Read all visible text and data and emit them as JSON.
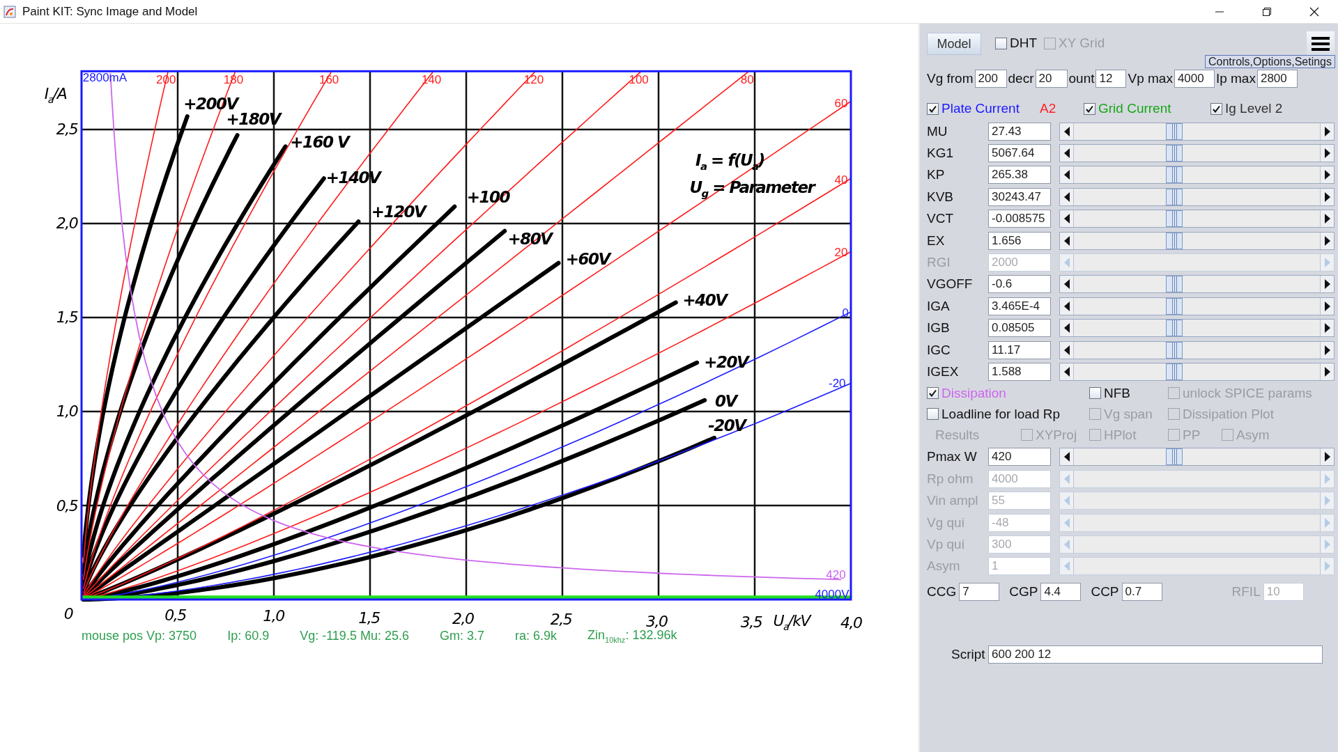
{
  "window": {
    "title": "Paint KIT: Sync Image and Model"
  },
  "plot": {
    "y_axis_label": "I$_{a}$/A",
    "y_ticks": [
      "2,5",
      "2,0",
      "1,5",
      "1,0",
      "0,5"
    ],
    "x_ticks": [
      "0",
      "0,5",
      "1,0",
      "1,5",
      "2,0",
      "2,5",
      "3,0",
      "3,5",
      "4,0"
    ],
    "x_axis_label": "U$_{a}$/kV",
    "curve_labels": [
      "+200V",
      "+180V",
      "+160 V",
      "+140V",
      "+120V",
      "+100",
      "+80V",
      "+60V",
      "+40V",
      "+20V",
      "0V",
      "-20V"
    ],
    "formula": [
      "I$_{a}$ = f(U$_{a}$)",
      "U$_{g}$ = Parameter"
    ],
    "overlay_labels": [
      {
        "text": "2800mA",
        "color": "#2020ff"
      },
      {
        "text": "200",
        "color": "#ff2020"
      },
      {
        "text": "180",
        "color": "#ff2020"
      },
      {
        "text": "160",
        "color": "#ff2020"
      },
      {
        "text": "140",
        "color": "#ff2020"
      },
      {
        "text": "120",
        "color": "#ff2020"
      },
      {
        "text": "100",
        "color": "#ff2020"
      },
      {
        "text": "80",
        "color": "#ff2020"
      },
      {
        "text": "60",
        "color": "#ff2020"
      },
      {
        "text": "40",
        "color": "#ff2020"
      },
      {
        "text": "20",
        "color": "#ff2020"
      },
      {
        "text": "0",
        "color": "#2020ff"
      },
      {
        "text": "-20",
        "color": "#2020ff"
      },
      {
        "text": "420",
        "color": "#cc66ee"
      },
      {
        "text": "4000V",
        "color": "#2020ff"
      }
    ],
    "readout": [
      "mouse pos Vp: 3750",
      "Ip: 60.9",
      "Vg: -119.5 Mu: 25.6",
      "Gm: 3.7",
      "ra: 6.9k",
      "Zin$_{10khz}$: 132.96k"
    ]
  },
  "model_button": "Model",
  "top_checks": [
    {
      "label": "DHT",
      "checked": false,
      "disabled": false
    },
    {
      "label": "XY Grid",
      "checked": false,
      "disabled": true
    }
  ],
  "menu_tooltip": "Controls,Options,Setings",
  "range_fields": [
    {
      "label": "Vg from",
      "value": "200"
    },
    {
      "label": "decr",
      "value": "20"
    },
    {
      "label": "ount",
      "value": "12"
    },
    {
      "label": "Vp max",
      "value": "4000"
    },
    {
      "label": "Ip max",
      "value": "2800"
    }
  ],
  "curve_checks": [
    {
      "kind": "checkbox",
      "label": "Plate Current",
      "checked": true,
      "color": "#1a1aff"
    },
    {
      "kind": "label",
      "label": "A2",
      "color": "#ff2020"
    },
    {
      "kind": "checkbox",
      "label": "Grid Current",
      "checked": true,
      "color": "#14a814"
    },
    {
      "kind": "checkbox",
      "label": "Ig Level 2",
      "checked": true,
      "color": "#333333"
    }
  ],
  "parameters": [
    {
      "name": "MU",
      "value": "27.43",
      "disabled": false,
      "level": 0.4
    },
    {
      "name": "KG1",
      "value": "5067.64",
      "disabled": false,
      "level": 0.4
    },
    {
      "name": "KP",
      "value": "265.38",
      "disabled": false,
      "level": 0.4
    },
    {
      "name": "KVB",
      "value": "30243.47",
      "disabled": false,
      "level": 0.4
    },
    {
      "name": "VCT",
      "value": "-0.008575",
      "disabled": false,
      "level": 0.4
    },
    {
      "name": "EX",
      "value": "1.656",
      "disabled": false,
      "level": 0.4
    },
    {
      "name": "RGI",
      "value": "2000",
      "disabled": true
    },
    {
      "name": "VGOFF",
      "value": "-0.6",
      "disabled": false,
      "level": 0.4
    },
    {
      "name": "IGA",
      "value": "3.465E-4",
      "disabled": false,
      "level": 0.4
    },
    {
      "name": "IGB",
      "value": "0.08505",
      "disabled": false,
      "level": 0.4
    },
    {
      "name": "IGC",
      "value": "11.17",
      "disabled": false,
      "level": 0.4
    },
    {
      "name": "IGEX",
      "value": "1.588",
      "disabled": false,
      "level": 0.4
    }
  ],
  "options": [
    [
      {
        "kind": "checkbox",
        "label": "Dissipation",
        "checked": true,
        "disabled": false,
        "color": "#cc66ee"
      },
      {
        "kind": "checkbox",
        "label": "NFB",
        "checked": false,
        "disabled": false
      },
      {
        "kind": "checkbox",
        "label": "unlock SPICE params",
        "checked": false,
        "disabled": true
      }
    ],
    [
      {
        "kind": "checkbox",
        "label": "Loadline for load Rp",
        "checked": false,
        "disabled": false
      },
      {
        "kind": "checkbox",
        "label": "Vg span",
        "checked": false,
        "disabled": true
      },
      {
        "kind": "checkbox",
        "label": "Dissipation Plot",
        "checked": false,
        "disabled": true
      }
    ],
    [
      {
        "kind": "label",
        "label": "Results",
        "disabled": true
      },
      {
        "kind": "checkbox",
        "label": "XYProj",
        "checked": false,
        "disabled": true
      },
      {
        "kind": "checkbox",
        "label": "HPlot",
        "checked": false,
        "disabled": true
      },
      {
        "kind": "checkbox",
        "label": "PP",
        "checked": false,
        "disabled": true
      },
      {
        "kind": "checkbox",
        "label": "Asym",
        "checked": false,
        "disabled": true
      }
    ]
  ],
  "load_parameters": [
    {
      "name": "Pmax W",
      "value": "420",
      "disabled": false,
      "level": 0.4
    },
    {
      "name": "Rp ohm",
      "value": "4000",
      "disabled": true
    },
    {
      "name": "Vin ampl",
      "value": "55",
      "disabled": true
    },
    {
      "name": "Vg qui",
      "value": "-48",
      "disabled": true
    },
    {
      "name": "Vp qui",
      "value": "300",
      "disabled": true
    },
    {
      "name": "Asym",
      "value": "1",
      "disabled": true
    }
  ],
  "capacitances": [
    {
      "label": "CCG",
      "value": "7",
      "disabled": false
    },
    {
      "label": "CGP",
      "value": "4.4",
      "disabled": false
    },
    {
      "label": "CCP",
      "value": "0.7",
      "disabled": false
    },
    {
      "label": "RFIL",
      "value": "10",
      "disabled": true
    }
  ],
  "script": {
    "label": "Script",
    "value": "600 200 12"
  }
}
